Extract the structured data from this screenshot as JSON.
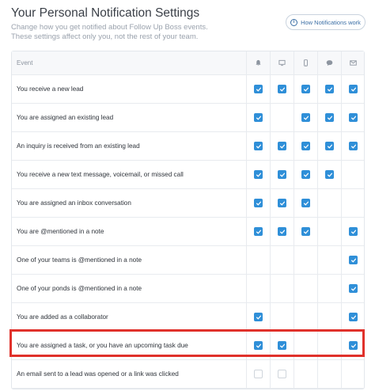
{
  "header": {
    "title": "Your Personal Notification Settings",
    "subtitle": "Change how you get notified about Follow Up Boss events. These settings affect only you, not the rest of your team.",
    "how_button": "How Notifications work",
    "how_icon": "info-icon"
  },
  "table": {
    "column_event": "Event",
    "channel_icons": [
      "bell-icon",
      "desktop-icon",
      "mobile-icon",
      "chat-bubble-icon",
      "email-icon"
    ],
    "rows": [
      {
        "label": "You receive a new lead",
        "checks": [
          "on",
          "on",
          "on",
          "on",
          "on"
        ]
      },
      {
        "label": "You are assigned an existing lead",
        "checks": [
          "on",
          "none",
          "on",
          "on",
          "on"
        ]
      },
      {
        "label": "An inquiry is received from an existing lead",
        "checks": [
          "on",
          "on",
          "on",
          "on",
          "on"
        ]
      },
      {
        "label": "You receive a new text message, voicemail, or missed call",
        "checks": [
          "on",
          "on",
          "on",
          "on",
          "none"
        ]
      },
      {
        "label": "You are assigned an inbox conversation",
        "checks": [
          "on",
          "on",
          "on",
          "none",
          "none"
        ]
      },
      {
        "label": "You are @mentioned in a note",
        "checks": [
          "on",
          "on",
          "on",
          "none",
          "on"
        ]
      },
      {
        "label": "One of your teams is @mentioned in a note",
        "checks": [
          "none",
          "none",
          "none",
          "none",
          "on"
        ]
      },
      {
        "label": "One of your ponds is @mentioned in a note",
        "checks": [
          "none",
          "none",
          "none",
          "none",
          "on"
        ]
      },
      {
        "label": "You are added as a collaborator",
        "checks": [
          "on",
          "none",
          "none",
          "none",
          "on"
        ]
      },
      {
        "label": "You are assigned a task, or you have an upcoming task due",
        "checks": [
          "on",
          "on",
          "none",
          "none",
          "on"
        ]
      },
      {
        "label": "An email sent to a lead was opened or a link was clicked",
        "checks": [
          "off",
          "off",
          "none",
          "none",
          "none"
        ]
      }
    ]
  },
  "colors": {
    "checkbox": "#2f8fd8",
    "highlight": "#e0312b",
    "link": "#3a6ea5"
  }
}
